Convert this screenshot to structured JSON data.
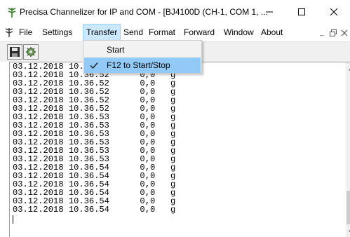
{
  "window": {
    "title": "Precisa Channelizer for IP and COM - [BJ4100D (CH-1, COM  1, ...",
    "icon": "app-plant-icon",
    "controls": [
      "minimize-icon",
      "maximize-icon",
      "close-icon"
    ]
  },
  "menubar": {
    "items": [
      {
        "label": "File"
      },
      {
        "label": "Settings"
      },
      {
        "label": "Transfer"
      },
      {
        "label": "Send"
      },
      {
        "label": "Format"
      },
      {
        "label": "Forward"
      },
      {
        "label": "Window"
      },
      {
        "label": "About"
      }
    ],
    "mdi_minimize": "_",
    "mdi_restore": "ȓ"
  },
  "toolbar": {
    "buttons": [
      "save-icon",
      "settings-gear-icon"
    ]
  },
  "dropdown": {
    "items": [
      {
        "label": "Start",
        "checked": false
      },
      {
        "label": "F12 to Start/Stop",
        "checked": true
      }
    ]
  },
  "log": {
    "lines": [
      "03.12.2018 10.36.52      0,0   g",
      "03.12.2018 10.36.52      0,0   g",
      "03.12.2018 10.36.52      0,0   g",
      "03.12.2018 10.36.52      0,0   g",
      "03.12.2018 10.36.52      0,0   g",
      "03.12.2018 10.36.52      0,0   g",
      "03.12.2018 10.36.53      0,0   g",
      "03.12.2018 10.36.53      0,0   g",
      "03.12.2018 10.36.53      0,0   g",
      "03.12.2018 10.36.53      0,0   g",
      "03.12.2018 10.36.53      0,0   g",
      "03.12.2018 10.36.53      0,0   g",
      "03.12.2018 10.36.54      0,0   g",
      "03.12.2018 10.36.54      0,0   g",
      "03.12.2018 10.36.54      0,0   g",
      "03.12.2018 10.36.54      0,0   g",
      "03.12.2018 10.36.54      0,0   g",
      "03.12.2018 10.36.54      0,0   g"
    ]
  },
  "colors": {
    "menu_highlight": "#cce8ff",
    "dropdown_highlight": "#91c9f7",
    "dropdown_bg": "#f2f2f2"
  }
}
